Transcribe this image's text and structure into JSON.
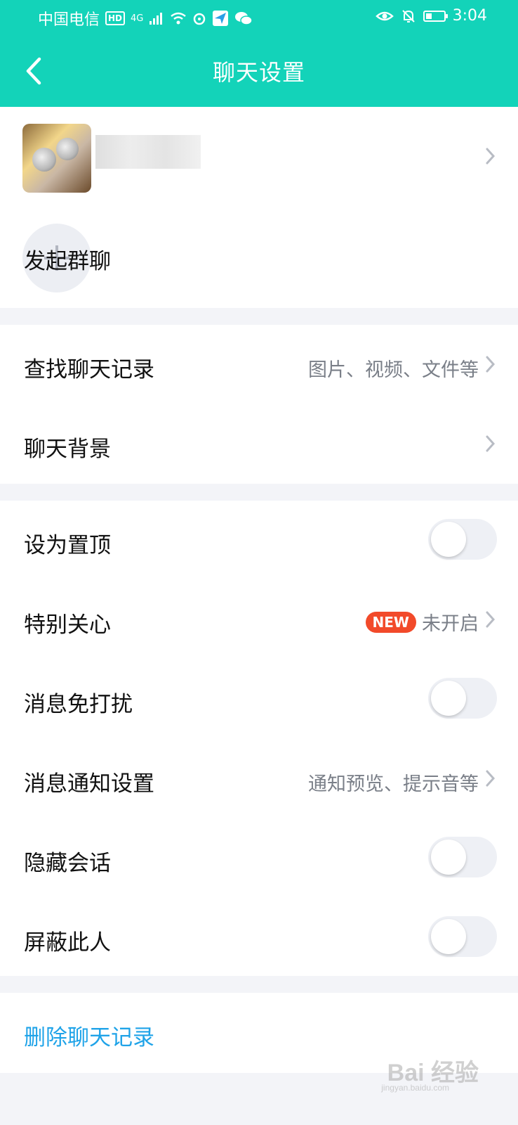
{
  "status_bar": {
    "carrier": "中国电信",
    "hd": "HD",
    "network": "4G",
    "time": "3:04"
  },
  "header": {
    "title": "聊天设置"
  },
  "contact": {
    "start_group_chat_label": "发起群聊"
  },
  "section_search": {
    "find_history_label": "查找聊天记录",
    "find_history_hint": "图片、视频、文件等",
    "chat_background_label": "聊天背景"
  },
  "section_options": {
    "pin_top_label": "设为置顶",
    "special_care_label": "特别关心",
    "special_care_badge": "NEW",
    "special_care_value": "未开启",
    "do_not_disturb_label": "消息免打扰",
    "notification_settings_label": "消息通知设置",
    "notification_settings_hint": "通知预览、提示音等",
    "hide_chat_label": "隐藏会话",
    "block_user_label": "屏蔽此人"
  },
  "section_delete": {
    "delete_history_label": "删除聊天记录"
  },
  "watermark": {
    "brand": "Bai 经验",
    "sub": "jingyan.baidu.com"
  },
  "colors": {
    "accent": "#13d3b9",
    "danger_link": "#1fa3e8",
    "badge": "#f24a2a"
  }
}
